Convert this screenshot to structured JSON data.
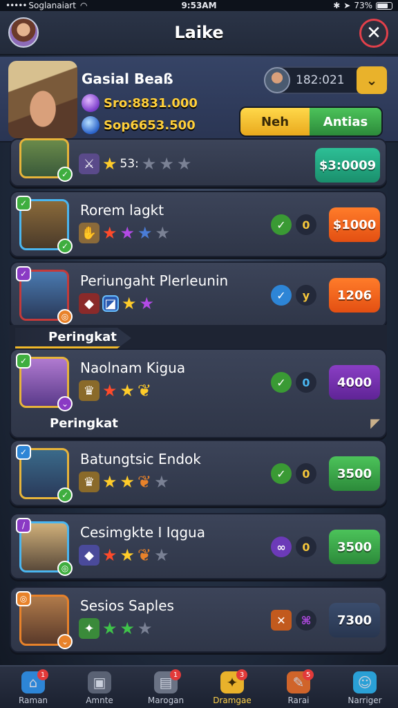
{
  "status": {
    "signal": "•••••",
    "carrier": "Soglanaiart",
    "time": "9:53AM",
    "battery": "73%"
  },
  "header": {
    "title": "Laike"
  },
  "hero": {
    "name": "Gasial Beaß",
    "stat1": "Sro:8831.000",
    "stat2": "Sop6653.500",
    "coin_value": "182:021",
    "toggle_left": "Neh",
    "toggle_right": "Antias"
  },
  "rows": [
    {
      "name": "",
      "stars_text": "53:",
      "price": "$3:0009"
    },
    {
      "name": "Rorem lagkt",
      "chip_value": "0",
      "price": "$1000"
    },
    {
      "name": "Periungaht Plerleunin",
      "chip_value": "y",
      "price": "1206"
    },
    {
      "name": "Naolnam Kigua",
      "chip_value": "0",
      "price": "4000"
    },
    {
      "name": "Batungtsic Endok",
      "chip_value": "0",
      "price": "3500"
    },
    {
      "name": "Cesimgkte I Iqgua",
      "chip_value": "0",
      "price": "3500"
    },
    {
      "name": "Sesios Saples",
      "chip_value": "",
      "price": "7300"
    }
  ],
  "section_label": "Peringkat",
  "sub_label": "Peringkat",
  "nav": [
    {
      "label": "Raman",
      "badge": "1"
    },
    {
      "label": "Amnte",
      "badge": ""
    },
    {
      "label": "Marogan",
      "badge": "1"
    },
    {
      "label": "Dramgae",
      "badge": "3"
    },
    {
      "label": "Rarai",
      "badge": "5"
    },
    {
      "label": "Narriger",
      "badge": ""
    }
  ]
}
